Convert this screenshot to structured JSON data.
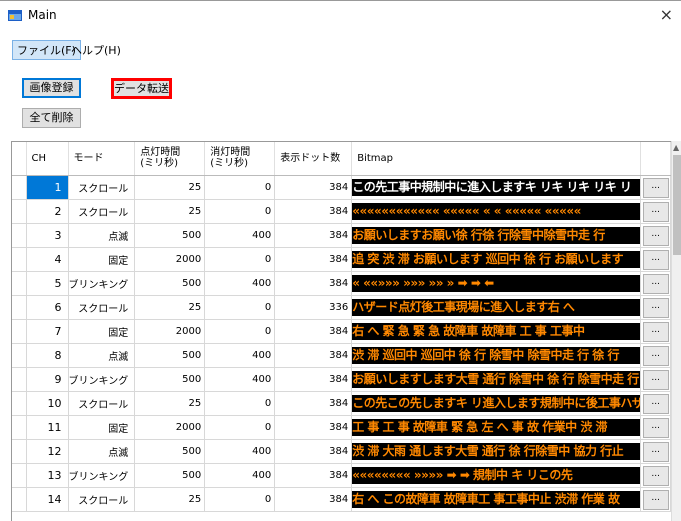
{
  "window": {
    "title": "Main",
    "close": "×"
  },
  "menu": {
    "file": "ファイル(F)",
    "help": "ヘルプ(H)"
  },
  "buttons": {
    "register": "画像登録",
    "transfer": "データ転送",
    "clear_all": "全て削除"
  },
  "columns": [
    "CH",
    "モード",
    "点灯時間\n(ミリ秒)",
    "消灯時間\n(ミリ秒)",
    "表示ドット数",
    "Bitmap"
  ],
  "rows": [
    {
      "ch": "1",
      "mode": "スクロール",
      "on": "25",
      "off": "0",
      "dots": "384",
      "bitmap": "この先工事中規制中に進入しますキ リキ リキ リキ リ",
      "color": "bright"
    },
    {
      "ch": "2",
      "mode": "スクロール",
      "on": "25",
      "off": "0",
      "dots": "384",
      "bitmap": "«««««««««««« ««««« « « ««««« «««««",
      "color": "orange"
    },
    {
      "ch": "3",
      "mode": "点滅",
      "on": "500",
      "off": "400",
      "dots": "384",
      "bitmap": "お願いしますお願い徐 行徐 行除雪中除雪中走 行",
      "color": "orange"
    },
    {
      "ch": "4",
      "mode": "固定",
      "on": "2000",
      "off": "0",
      "dots": "384",
      "bitmap": "追 突 渋 滞 お願いします 巡回中 徐 行 お願いします",
      "color": "orange"
    },
    {
      "ch": "5",
      "mode": "ブリンキング",
      "on": "500",
      "off": "400",
      "dots": "384",
      "bitmap": "« ««»»» »»» »» » ➡ ➡ ⬅",
      "color": "orange"
    },
    {
      "ch": "6",
      "mode": "スクロール",
      "on": "25",
      "off": "0",
      "dots": "336",
      "bitmap": "ハザード点灯後工事現場に進入します右 へ",
      "color": "orange"
    },
    {
      "ch": "7",
      "mode": "固定",
      "on": "2000",
      "off": "0",
      "dots": "384",
      "bitmap": "右 へ 緊 急 緊 急 故障車 故障車 工 事 工事中",
      "color": "orange"
    },
    {
      "ch": "8",
      "mode": "点滅",
      "on": "500",
      "off": "400",
      "dots": "384",
      "bitmap": "渋 滞 巡回中 巡回中 徐 行 除雪中 除雪中走 行 徐 行",
      "color": "orange"
    },
    {
      "ch": "9",
      "mode": "ブリンキング",
      "on": "500",
      "off": "400",
      "dots": "384",
      "bitmap": "お願いしますします大雪 通行 除雪中 徐 行 除雪中走 行",
      "color": "orange"
    },
    {
      "ch": "10",
      "mode": "スクロール",
      "on": "25",
      "off": "0",
      "dots": "384",
      "bitmap": "この先この先しますキ リ進入します規制中に後工事ハザー",
      "color": "orange"
    },
    {
      "ch": "11",
      "mode": "固定",
      "on": "2000",
      "off": "0",
      "dots": "384",
      "bitmap": "工 事 工 事 故障車 緊 急 左 へ 事 故 作業中 渋 滞",
      "color": "orange"
    },
    {
      "ch": "12",
      "mode": "点滅",
      "on": "500",
      "off": "400",
      "dots": "384",
      "bitmap": "渋 滞 大雨 通します大雪 通行 徐 行除雪中 協力 行止",
      "color": "orange"
    },
    {
      "ch": "13",
      "mode": "ブリンキング",
      "on": "500",
      "off": "400",
      "dots": "384",
      "bitmap": "«««««««« »»»» ➡ ➡ 規制中 キ リこの先",
      "color": "orange"
    },
    {
      "ch": "14",
      "mode": "スクロール",
      "on": "25",
      "off": "0",
      "dots": "384",
      "bitmap": "右 へ この故障車 故障車工 事工事中止 渋滞 作業 故",
      "color": "orange"
    }
  ],
  "row_button_label": "..."
}
